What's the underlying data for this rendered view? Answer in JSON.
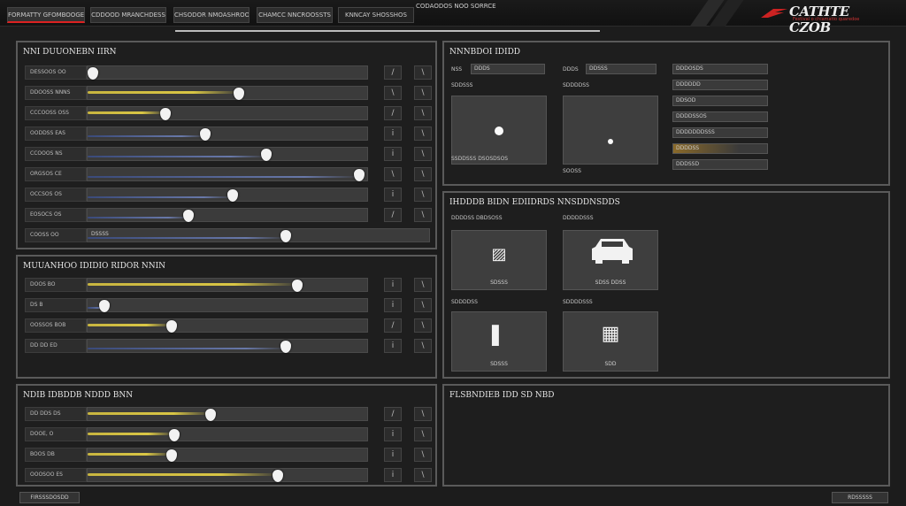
{
  "topbar": {
    "tabs": [
      "FORMATTY GFOMBOOGE",
      "CDDOOD MRANCHDESS",
      "CHSODOR NMOASHROOS",
      "CHAMCC NNCROOSSTS",
      "KNNCAY SHOSSHOS"
    ],
    "center_text": "CODAODOS NOO SORRCE",
    "logo_text": "CATHTE CZOB",
    "logo_sub": "Festival o chiamatio quaredoe"
  },
  "left": {
    "panel1": {
      "title": "NNI DUUONEBN IIRN",
      "rows": [
        {
          "label": "DESSOOS  OO",
          "trail": "y",
          "value": 0.02
        },
        {
          "label": "DDOOSS   NNNS",
          "trail": "y",
          "value": 0.54
        },
        {
          "label": "CCCOOSS  OSS",
          "trail": "y",
          "value": 0.28
        },
        {
          "label": "OODDSS   EAS",
          "trail": "b",
          "value": 0.42
        },
        {
          "label": "CCOOOS   NS",
          "trail": "b",
          "value": 0.64
        },
        {
          "label": "ORGSOS   CE",
          "trail": "b",
          "value": 0.97
        },
        {
          "label": "OCCSOS   OS",
          "trail": "b",
          "value": 0.52
        },
        {
          "label": "EOSOCS   OS",
          "trail": "b",
          "value": 0.36
        }
      ],
      "wide_row": {
        "label": "COOSS   OO",
        "inner": "DSSSS",
        "value": 0.58
      },
      "icons_a": [
        "/",
        "\\",
        "/",
        "i",
        "i",
        "\\",
        "i",
        "/"
      ],
      "icons_b": [
        "\\",
        "\\",
        "\\",
        "\\",
        "\\",
        "\\",
        "\\",
        "\\"
      ]
    },
    "panel2": {
      "title": "MUUANHOO IDIDIO RIDOR NNIN",
      "rows": [
        {
          "label": "DOOS    BO",
          "trail": "y",
          "value": 0.75
        },
        {
          "label": "DS     B",
          "trail": "b",
          "value": 0.06
        },
        {
          "label": "OOSSOS  BOB",
          "trail": "y",
          "value": 0.3
        },
        {
          "label": "DD DD   ED",
          "trail": "b",
          "value": 0.71
        }
      ],
      "icons_a": [
        "i",
        "i",
        "/",
        "i"
      ],
      "icons_b": [
        "\\",
        "\\",
        "\\",
        "\\"
      ]
    },
    "panel3": {
      "title": "NDIB IDBDDB NDDD BNN",
      "rows": [
        {
          "label": "DD DDS   DS",
          "trail": "y",
          "value": 0.44
        },
        {
          "label": "DOOE,    O",
          "trail": "y",
          "value": 0.31
        },
        {
          "label": "BOOS     DB",
          "trail": "y",
          "value": 0.3
        },
        {
          "label": "OOOSOO   ES",
          "trail": "y",
          "value": 0.68
        }
      ],
      "icons_a": [
        "/",
        "i",
        "i",
        "i"
      ],
      "icons_b": [
        "\\",
        "\\",
        "\\",
        "\\"
      ]
    }
  },
  "right": {
    "panel1": {
      "title": "NNNBDOI IDIDD",
      "field1_label": "NSS",
      "field1_value": "DDDS",
      "field2_label": "DDDS",
      "field2_value": "DDSSS",
      "box1_head": "SDDSSS",
      "box2_head": "SDDDDSS",
      "box1_cap": "SSDDSSS DSOSDSOS",
      "box2_cap": "SOOSS",
      "list": [
        "DDDOSDS",
        "DDDDDD",
        "DDSOD",
        "DDDDSSOS",
        "DDDDDDDSSS",
        "DDDDSS",
        "DDDSSD"
      ]
    },
    "panel2": {
      "title": "IHDDDB BIDN EDIIDRDS  NNSDDNSDDS",
      "h1": "DDDDSS DBDSOSS",
      "h2": "DDDDDSSS",
      "h3": "SDDDDSS",
      "h4": "SDDDDSSS",
      "box1_cap": "SDSSS",
      "box2_cap": "SDSS DDSS",
      "box3_cap": "SDSSS",
      "box4_cap": "SDD"
    },
    "panel3": {
      "title": "FLSBNDIEB IDD SD NBD"
    }
  },
  "footer": {
    "left_button": "FIRSSSDOSDD",
    "right_button": "RDSSSSS"
  }
}
